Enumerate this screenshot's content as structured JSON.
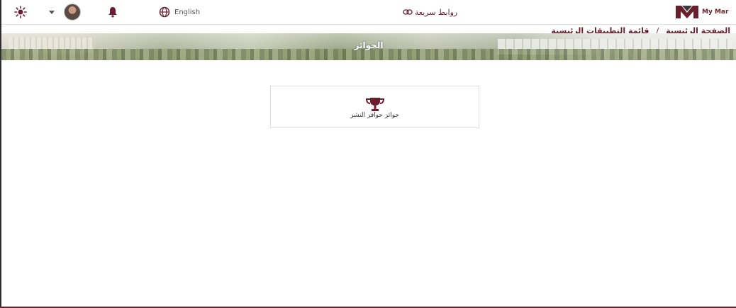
{
  "header": {
    "theme_icon": "sun-icon",
    "user_menu_icon": "chevron-down-icon",
    "notification_icon": "bell-icon",
    "language_icon": "globe-icon",
    "language_label": "English",
    "quick_links_label": "روابط سريعة",
    "quick_links_icon": "link-icon",
    "logo_text": "My Mar",
    "brand_color": "#6b1e2e"
  },
  "breadcrumb": {
    "items": [
      "الصفحة الرئيسية",
      "قائمة التطبيقات الرئيسية"
    ],
    "separator": "/"
  },
  "banner": {
    "title": "الجوائز"
  },
  "cards": [
    {
      "icon": "trophy-icon",
      "label": "جوائز حوافز النشر"
    }
  ]
}
